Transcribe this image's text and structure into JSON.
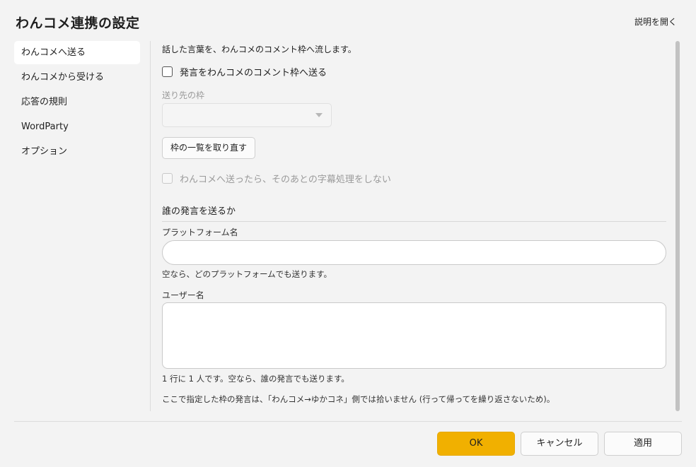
{
  "header": {
    "title": "わんコメ連携の設定",
    "help_label": "説明を開く"
  },
  "sidebar": {
    "items": [
      {
        "label": "わんコメへ送る",
        "active": true
      },
      {
        "label": "わんコメから受ける",
        "active": false
      },
      {
        "label": "応答の規則",
        "active": false
      },
      {
        "label": "WordParty",
        "active": false
      },
      {
        "label": "オプション",
        "active": false
      }
    ]
  },
  "main": {
    "description": "話した言葉を、わんコメのコメント枠へ流します。",
    "send_checkbox_label": "発言をわんコメのコメント枠へ送る",
    "send_checked": false,
    "target_label": "送り先の枠",
    "target_value": "",
    "refresh_button": "枠の一覧を取り直す",
    "skip_subtitle_label": "わんコメへ送ったら、そのあとの字幕処理をしない",
    "skip_subtitle_checked": false,
    "section_title": "誰の発言を送るか",
    "platform_label": "プラットフォーム名",
    "platform_value": "",
    "platform_hint": "空なら、どのプラットフォームでも送ります。",
    "user_label": "ユーザー名",
    "user_value": "",
    "user_hint": "1 行に 1 人です。空なら、誰の発言でも送ります。",
    "note": "ここで指定した枠の発言は、「わんコメ→ゆかコネ」側では拾いません (行って帰ってを繰り返さないため)。"
  },
  "footer": {
    "ok": "OK",
    "cancel": "キャンセル",
    "apply": "適用"
  },
  "colors": {
    "accent": "#f1b000",
    "background": "#f3f3f3"
  }
}
